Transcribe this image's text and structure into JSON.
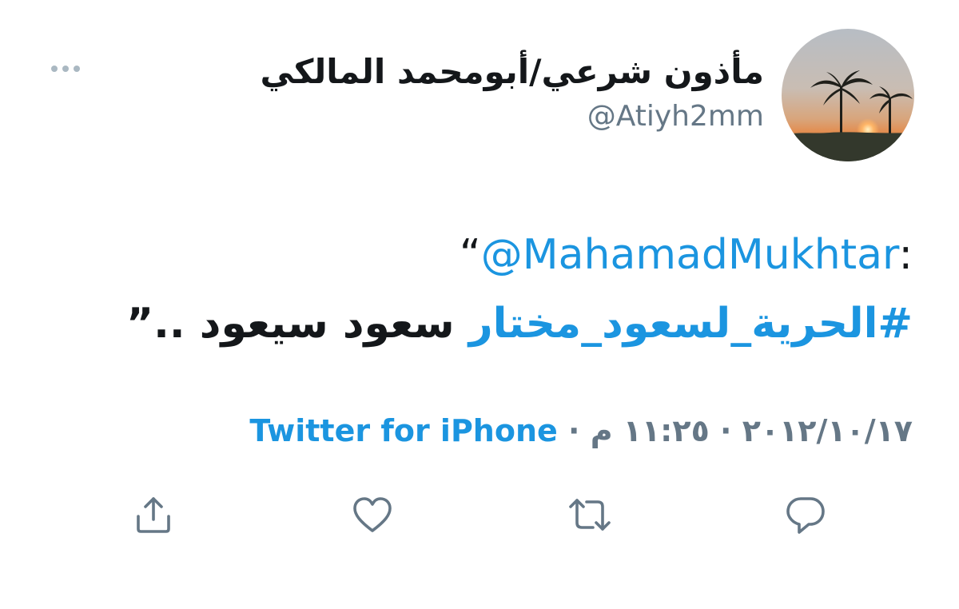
{
  "user": {
    "display_name": "مأذون شرعي/أبومحمد المالكي",
    "handle": "@Atiyh2mm"
  },
  "tweet": {
    "open_quote": "“",
    "mention": "@MahamadMukhtar",
    "colon": ":",
    "hashtag": "#الحرية_لسعود_مختار",
    "body": " سعود سيعود ..",
    "close_quote": "”"
  },
  "meta": {
    "date": "٢٠١٢/١٠/١٧",
    "separator1": " · ",
    "time": "١١:٢٥ م",
    "separator2": " · ",
    "source": "Twitter for iPhone"
  },
  "icons": {
    "more": "more-icon",
    "reply": "reply-icon",
    "retweet": "retweet-icon",
    "like": "like-icon",
    "share": "share-icon"
  },
  "colors": {
    "link": "#1b95e0",
    "text": "#14171a",
    "secondary": "#657786",
    "icon": "#657786"
  }
}
